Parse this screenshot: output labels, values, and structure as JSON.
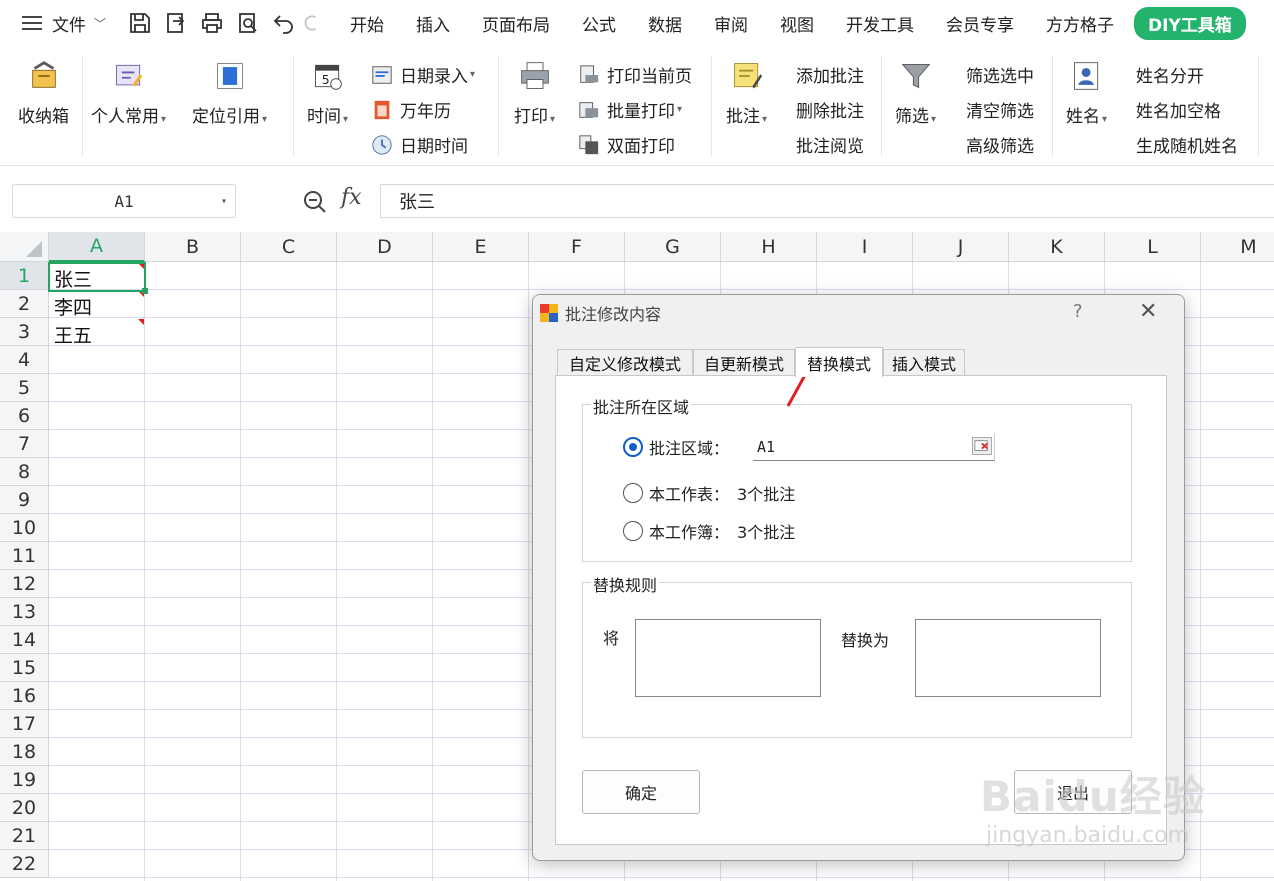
{
  "menubar": {
    "file_label": "文件",
    "tabs": [
      "开始",
      "插入",
      "页面布局",
      "公式",
      "数据",
      "审阅",
      "视图",
      "开发工具",
      "会员专享",
      "方方格子"
    ],
    "diy_tab": "DIY工具箱"
  },
  "ribbon": {
    "storage": "收纳箱",
    "personal": "个人常用",
    "locate": "定位引用",
    "time": "时间",
    "date_entry": "日期录入",
    "calendar": "万年历",
    "date_time": "日期时间",
    "print": "打印",
    "print_current": "打印当前页",
    "batch_print": "批量打印",
    "duplex_print": "双面打印",
    "comment": "批注",
    "add_comment": "添加批注",
    "delete_comment": "删除批注",
    "view_comment": "批注阅览",
    "filter": "筛选",
    "filter_selected": "筛选选中",
    "clear_filter": "清空筛选",
    "advanced_filter": "高级筛选",
    "name": "姓名",
    "split_name": "姓名分开",
    "name_space": "姓名加空格",
    "random_name": "生成随机姓名"
  },
  "formula_bar": {
    "name_box": "A1",
    "fx": "fx",
    "content": "张三"
  },
  "sheet": {
    "columns": [
      "A",
      "B",
      "C",
      "D",
      "E",
      "F",
      "G",
      "H",
      "I",
      "J",
      "K",
      "L",
      "M"
    ],
    "rows": [
      "1",
      "2",
      "3",
      "4",
      "5",
      "6",
      "7",
      "8",
      "9",
      "10",
      "11",
      "12",
      "13",
      "14",
      "15",
      "16",
      "17",
      "18",
      "19",
      "20",
      "21",
      "22"
    ],
    "cells": {
      "A1": "张三",
      "A2": "李四",
      "A3": "王五"
    }
  },
  "dialog": {
    "title": "批注修改内容",
    "help": "?",
    "close": "✕",
    "tabs": [
      "自定义修改模式",
      "自更新模式",
      "替换模式",
      "插入模式"
    ],
    "region_group": "批注所在区域",
    "opt_range": "批注区域：",
    "range_value": "A1",
    "opt_sheet": "本工作表：",
    "sheet_count": "3个批注",
    "opt_workbook": "本工作簿：",
    "workbook_count": "3个批注",
    "rule_group": "替换规则",
    "from_label": "将",
    "to_label": "替换为",
    "ok": "确定",
    "exit": "退出"
  },
  "watermark": {
    "main": "Baidu经验",
    "sub": "jingyan.baidu.com"
  },
  "colors": {
    "accent_green": "#23a463",
    "diy_green": "#23b36d",
    "radio_blue": "#0e5fc7",
    "arrow_red": "#e02020"
  }
}
